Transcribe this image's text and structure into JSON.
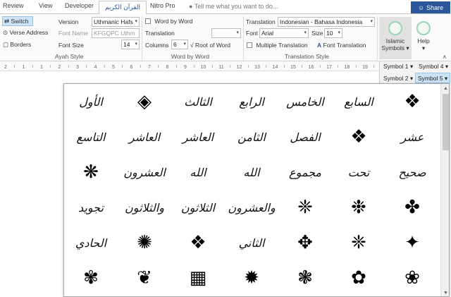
{
  "tabs": [
    {
      "label": "Review",
      "active": false
    },
    {
      "label": "View",
      "active": false
    },
    {
      "label": "Developer",
      "active": false
    },
    {
      "label": "القرآن الكريم",
      "active": true
    },
    {
      "label": "Nitro Pro",
      "active": false
    }
  ],
  "tell_me": "Tell me what you want to do...",
  "share": "Share",
  "ayah_style": {
    "switch": "Switch",
    "verse_address": "Verse Address",
    "borders": "Borders",
    "version_label": "Version",
    "version_value": "Uthmanic Hafs",
    "font_name_label": "Font Name",
    "font_name_value": "KFGQPC Uthm",
    "font_size_label": "Font Size",
    "font_size_value": "14",
    "group": "Ayah Style"
  },
  "word_by_word": {
    "word_by_word": "Word by Word",
    "translation_label": "Translation",
    "translation_value": "",
    "columns_label": "Columns",
    "columns_value": "6",
    "root_of_word": "Root of Word",
    "group": "Word by Word"
  },
  "translation_style": {
    "translation_label": "Translation",
    "translation_value": "Indonesian - Bahasa Indonesia",
    "font_label": "Font",
    "font_value": "Arial",
    "size_label": "Size",
    "size_value": "10",
    "multiple_translation": "Multiple Translation",
    "font_translation": "Font Translation",
    "group": "Translation Style"
  },
  "islamic_symbols": {
    "line1": "Islamic",
    "line2": "Symbols"
  },
  "help": {
    "label": "Help"
  },
  "ruler_numbers": [
    "2",
    "1",
    "1",
    "2",
    "3",
    "4",
    "5",
    "6",
    "7",
    "8",
    "9",
    "10",
    "11",
    "12",
    "13",
    "14",
    "15",
    "16",
    "17",
    "18",
    "19"
  ],
  "symbol_buttons": {
    "s1": "Symbol 1",
    "s4": "Symbol 4",
    "s2": "Symbol 2",
    "s5": "Symbol 5"
  },
  "colors": {
    "accent": "#2b579a",
    "selected": "#cde3f7"
  },
  "gallery": [
    [
      "الأول",
      "◈",
      "الثالث",
      "الرابع",
      "الخامس",
      "السابع",
      "❖"
    ],
    [
      "التاسع",
      "العاشر",
      "العاشر",
      "الثامن",
      "الفصل",
      "❖",
      "عشر"
    ],
    [
      "❋",
      "العشرون",
      "الله",
      "الله",
      "مجموع",
      "تحت",
      "صحيح"
    ],
    [
      "تجويد",
      "والثلاثون",
      "الثلاثون",
      "والعشرون",
      "❈",
      "❉",
      "✤"
    ],
    [
      "الحادي",
      "✺",
      "❖",
      "الثاني",
      "✥",
      "❈",
      "✦"
    ],
    [
      "✾",
      "❦",
      "▦",
      "✹",
      "❃",
      "✿",
      "❀"
    ]
  ]
}
